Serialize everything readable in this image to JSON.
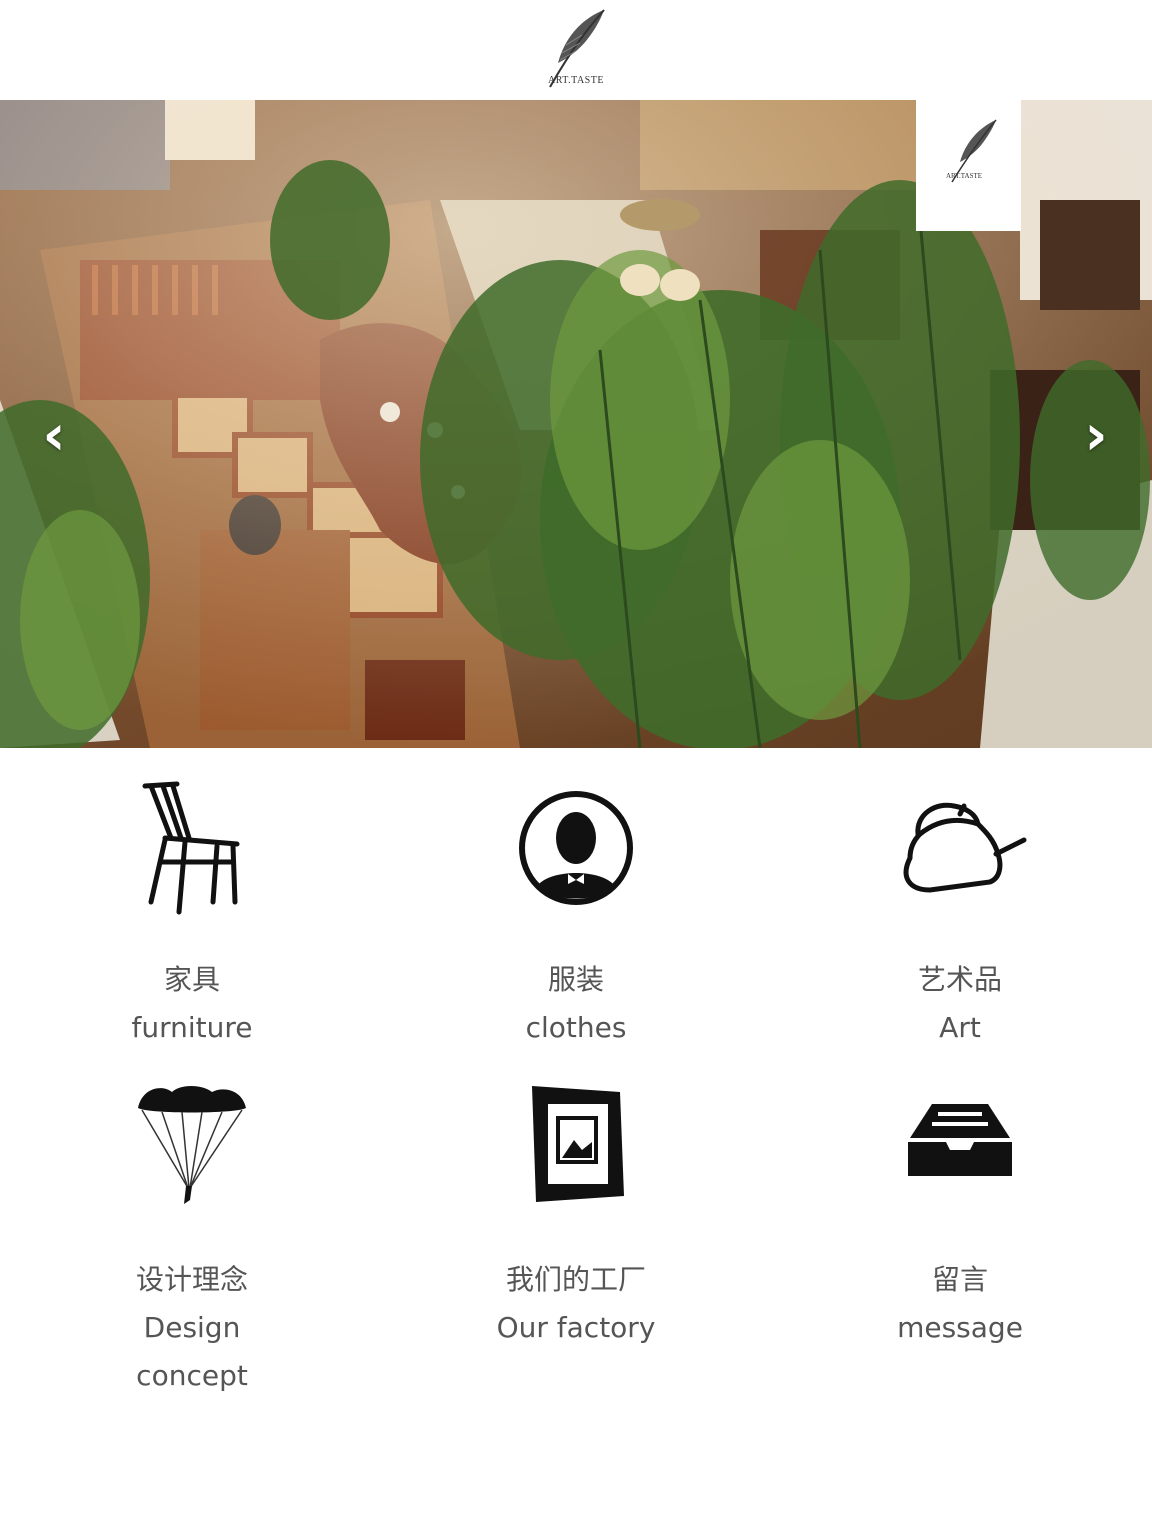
{
  "header": {
    "logo_text": "ART.TASTE"
  },
  "hero": {
    "badge_text": "ART.TASTE",
    "prev_label": "‹",
    "next_label": "›"
  },
  "categories": [
    {
      "cn": "家具",
      "en": "furniture",
      "icon": "chair-icon"
    },
    {
      "cn": "服装",
      "en": "clothes",
      "icon": "portrait-icon"
    },
    {
      "cn": "艺术品",
      "en": "Art",
      "icon": "teapot-icon"
    },
    {
      "cn": "设计理念",
      "en": "Design concept",
      "icon": "parachute-icon"
    },
    {
      "cn": "我们的工厂",
      "en": "Our factory",
      "icon": "picture-frame-icon"
    },
    {
      "cn": "留言",
      "en": "message",
      "icon": "inbox-tray-icon"
    }
  ]
}
